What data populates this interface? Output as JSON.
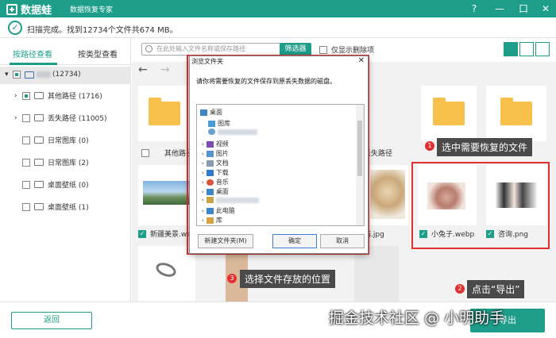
{
  "app": {
    "title": "数据蛙",
    "subtitle": "数据恢复专家",
    "controls": [
      "?",
      "—",
      "口",
      "✕"
    ]
  },
  "status": {
    "text": "扫描完成。找到12734个文件共674 MB。"
  },
  "left": {
    "tabs": [
      "按路径查看",
      "按类型查看"
    ],
    "root_count": "(12734)",
    "nodes": [
      {
        "label": "其他路径 (1716)"
      },
      {
        "label": "丢失路径 (11005)"
      },
      {
        "label": "日常图库 (0)"
      },
      {
        "label": "日常图库 (2)"
      },
      {
        "label": "桌面壁纸 (0)"
      },
      {
        "label": "桌面壁纸 (1)"
      }
    ]
  },
  "toolbar": {
    "search_placeholder": "在此处输入文件名称或保存路径",
    "filter_label": "筛选器",
    "only_deleted": "仅显示删除项"
  },
  "grid": {
    "row1_labels": [
      "其他路径",
      "丢失路径"
    ],
    "row2_labels": [
      "新疆美景.we",
      "猫.jpg",
      "小兔子.webp",
      "咨询.png"
    ]
  },
  "dialog": {
    "title": "浏览文件夹",
    "message": "请你将需要恢复的文件保存到原丢失数据的磁盘。",
    "tree": [
      "桌面",
      "图库",
      "视频",
      "图片",
      "文档",
      "下载",
      "音乐",
      "桌面",
      "此电脑",
      "库"
    ],
    "btn_new": "新建文件夹(M)",
    "btn_ok": "确定",
    "btn_cancel": "取消"
  },
  "annotations": {
    "step1": "选中需要恢复的文件",
    "step2": "点击“导出”",
    "step3": "选择文件存放的位置",
    "n1": "1",
    "n2": "2",
    "n3": "3"
  },
  "footer": {
    "back": "返回",
    "export": "导出"
  },
  "watermark": "掘金技术社区 @ 小明助手",
  "colors": {
    "brand": "#1e9e8a",
    "annotation": "#e03030",
    "folder": "#f7c04a"
  }
}
